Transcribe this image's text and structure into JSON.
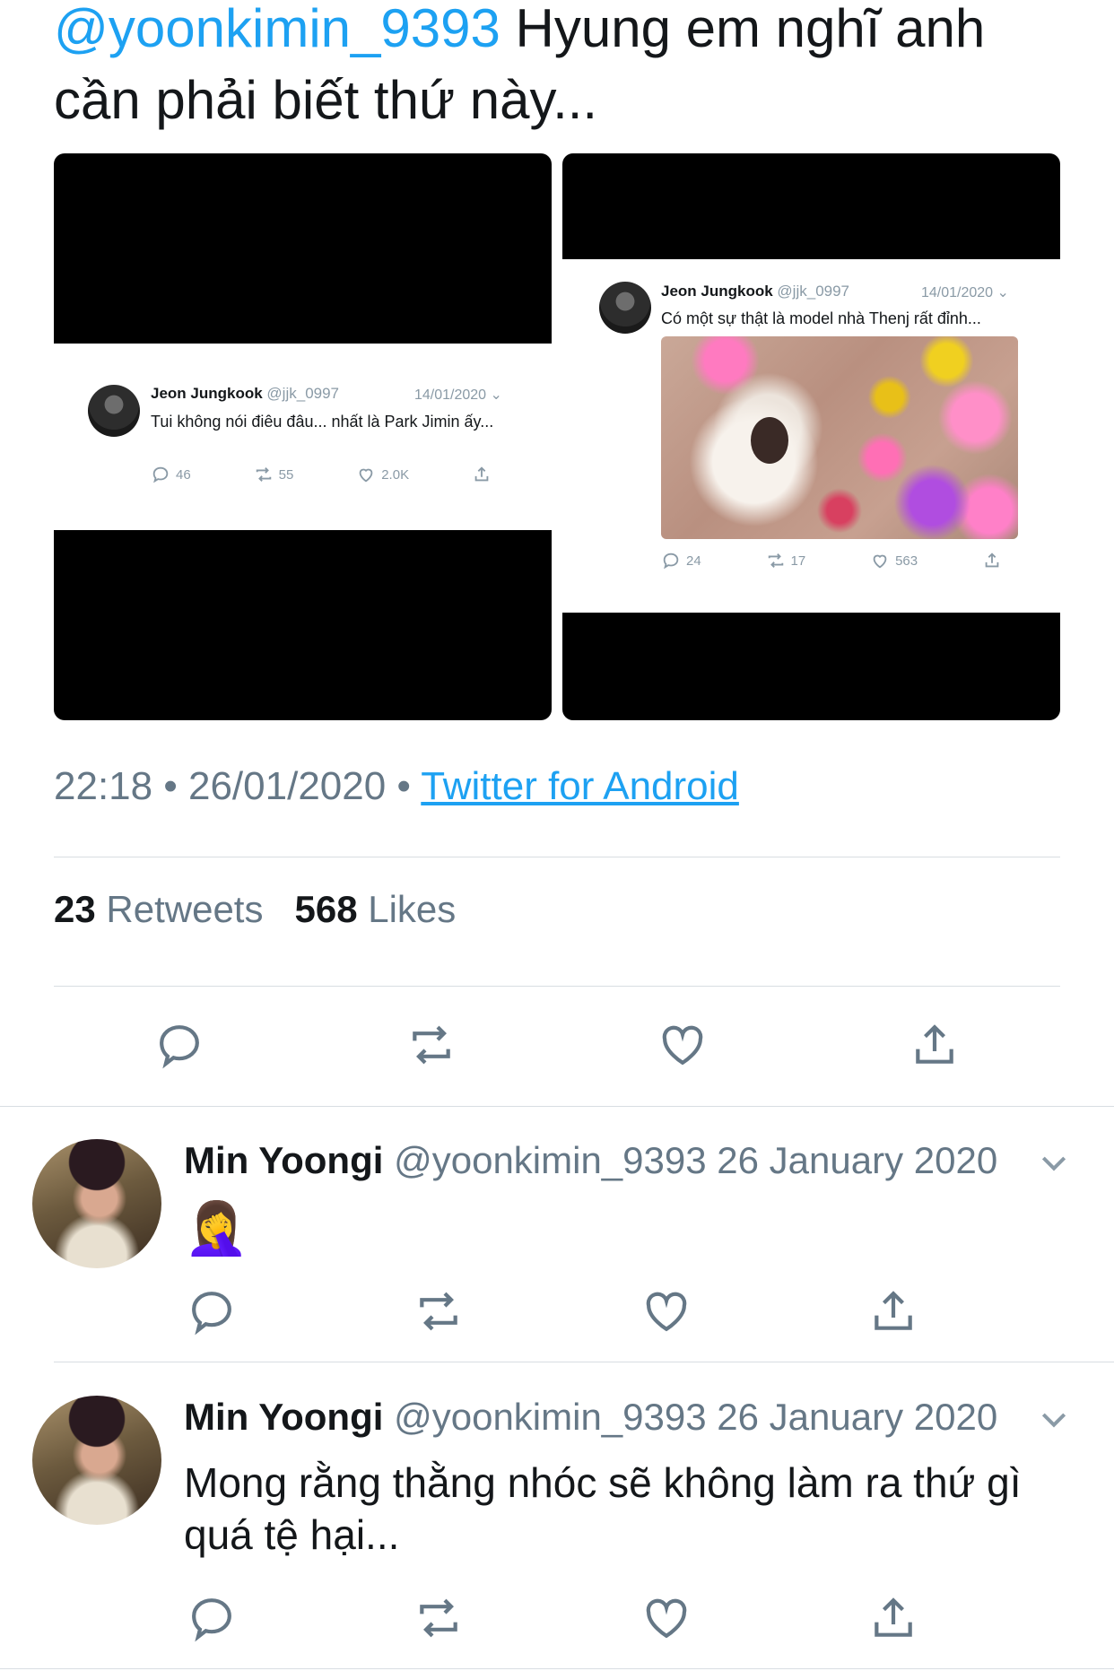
{
  "main_tweet": {
    "mention": "@yoonkimin_9393",
    "text": "Hyung em nghĩ anh cần phải biết thứ này..."
  },
  "screenshot_left": {
    "name": "Jeon Jungkook",
    "handle": "@jjk_0997",
    "date": "14/01/2020",
    "text": "Tui không nói điêu đâu... nhất là Park Jimin ấy...",
    "replies": "46",
    "retweets": "55",
    "likes": "2.0K"
  },
  "screenshot_right": {
    "name": "Jeon Jungkook",
    "handle": "@jjk_0997",
    "date": "14/01/2020",
    "text": "Có một sự thật là model nhà Thenj rất đỉnh...",
    "replies": "24",
    "retweets": "17",
    "likes": "563"
  },
  "meta": {
    "time": "22:18",
    "separator": "•",
    "date": "26/01/2020",
    "source": "Twitter for Android"
  },
  "stats": {
    "retweets_count": "23",
    "retweets_label": "Retweets",
    "likes_count": "568",
    "likes_label": "Likes"
  },
  "icons": [
    "reply-icon",
    "retweet-icon",
    "like-icon",
    "share-icon",
    "chevron-down-icon"
  ],
  "replies": [
    {
      "name": "Min Yoongi",
      "handle": "@yoonkimin_9393",
      "date": "26 January 2020",
      "text": "",
      "emoji": "🤦‍♀️"
    },
    {
      "name": "Min Yoongi",
      "handle": "@yoonkimin_9393",
      "date": "26 January 2020",
      "text": "Mong rằng thằng nhóc sẽ không làm ra thứ gì quá tệ hại..."
    }
  ],
  "colors": {
    "accent": "#1da1f2",
    "text": "#14171a",
    "muted": "#657786",
    "icon": "#657786",
    "divider": "#d8dde2"
  }
}
